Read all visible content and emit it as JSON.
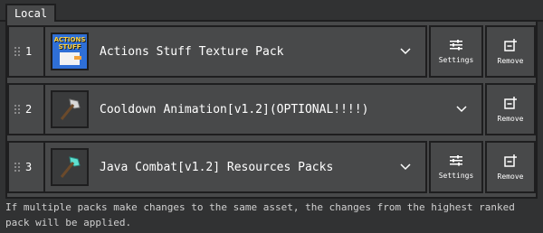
{
  "tab": {
    "label": "Local"
  },
  "packs": [
    {
      "rank": "1",
      "name": "Actions Stuff Texture Pack",
      "thumb_text": "ACTIONS STUFF",
      "icon": "actions-stuff-logo",
      "has_settings": true
    },
    {
      "rank": "2",
      "name": "Cooldown Animation[v1.2](OPTIONAL!!!!)",
      "icon": "iron-axe-icon",
      "has_settings": false
    },
    {
      "rank": "3",
      "name": "Java Combat[v1.2] Resources Packs",
      "icon": "diamond-axe-icon",
      "has_settings": true
    }
  ],
  "buttons": {
    "settings_label": "Settings",
    "remove_label": "Remove"
  },
  "footer": {
    "note": "If multiple packs make changes to the same asset, the changes from the highest ranked pack will be applied."
  },
  "colors": {
    "background": "#313233",
    "panel": "#48494a",
    "border": "#1e1e1f",
    "text": "#ffffff"
  }
}
